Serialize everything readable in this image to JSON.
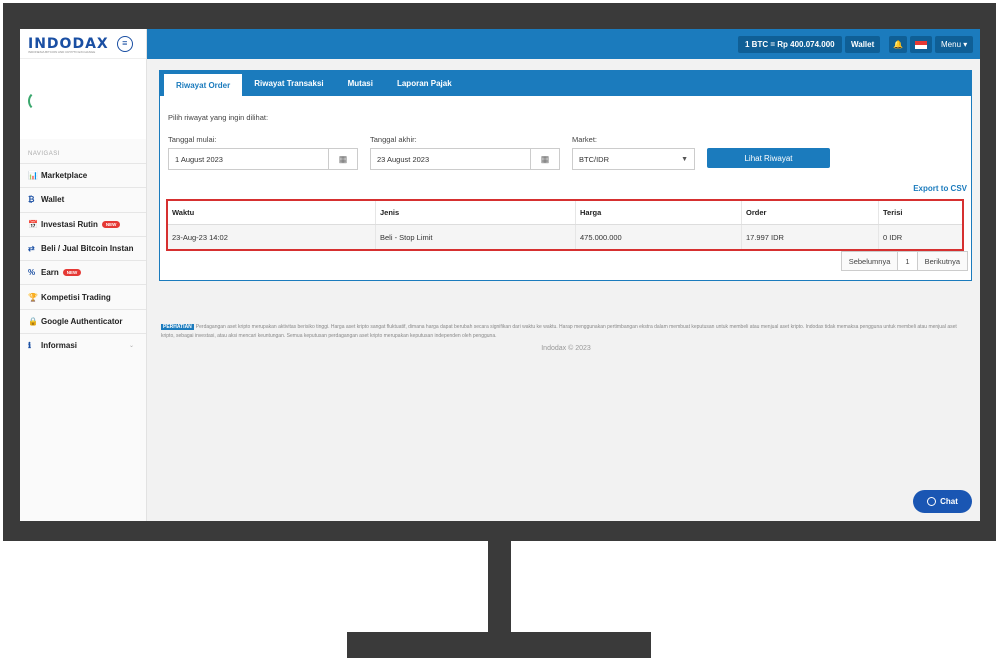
{
  "brand": {
    "logo": "INDODAX",
    "tagline": "INDONESIA BITCOIN AND CRYPTO EXCHANGE"
  },
  "topbar": {
    "btc_rate": "1 BTC = Rp 400.074.000",
    "wallet": "Wallet",
    "menu": "Menu ▾"
  },
  "sidebar": {
    "heading": "NAVIGASI",
    "items": [
      {
        "icon": "📊",
        "label": "Marketplace"
      },
      {
        "icon": "₿",
        "label": "Wallet"
      },
      {
        "icon": "📅",
        "label": "Investasi Rutin",
        "badge": "NEW"
      },
      {
        "icon": "⇄",
        "label": "Beli / Jual Bitcoin Instan"
      },
      {
        "icon": "%",
        "label": "Earn",
        "badge": "NEW"
      },
      {
        "icon": "🏆",
        "label": "Kompetisi Trading"
      },
      {
        "icon": "🔒",
        "label": "Google Authenticator"
      },
      {
        "icon": "ℹ",
        "label": "Informasi"
      }
    ]
  },
  "tabs": [
    "Riwayat Order",
    "Riwayat Transaksi",
    "Mutasi",
    "Laporan Pajak"
  ],
  "filter": {
    "prompt": "Pilih riwayat yang ingin dilihat:",
    "start_label": "Tanggal mulai:",
    "start_value": "1 August 2023",
    "end_label": "Tanggal akhir:",
    "end_value": "23 August 2023",
    "market_label": "Market:",
    "market_value": "BTC/IDR",
    "submit": "Lihat Riwayat"
  },
  "export": "Export to CSV",
  "table": {
    "headers": [
      "Waktu",
      "Jenis",
      "Harga",
      "Order",
      "Terisi"
    ],
    "rows": [
      [
        "23-Aug-23 14:02",
        "Beli - Stop Limit",
        "475.000.000",
        "17.997 IDR",
        "0 IDR"
      ]
    ]
  },
  "pagination": {
    "prev": "Sebelumnya",
    "page": "1",
    "next": "Berikutnya"
  },
  "notice": {
    "tag": "PERHATIAN",
    "text": "Perdagangan aset kripto merupakan aktivitas berisiko tinggi. Harga aset kripto sangat fluktuatif, dimana harga dapat berubah secara signifikan dari waktu ke waktu. Harap menggunakan pertimbangan ekstra dalam membuat keputusan untuk membeli atau menjual aset kripto. Indodax tidak memaksa pengguna untuk membeli atau menjual aset kripto, sebagai investasi, atau aksi mencari keuntungan. Semua keputusan perdagangan aset kripto merupakan keputusan independen oleh pengguna."
  },
  "footer": "Indodax © 2023",
  "chat": "Chat",
  "colors": {
    "primary": "#1b7bbd",
    "highlight": "#d63030",
    "chat": "#1a56b3"
  }
}
